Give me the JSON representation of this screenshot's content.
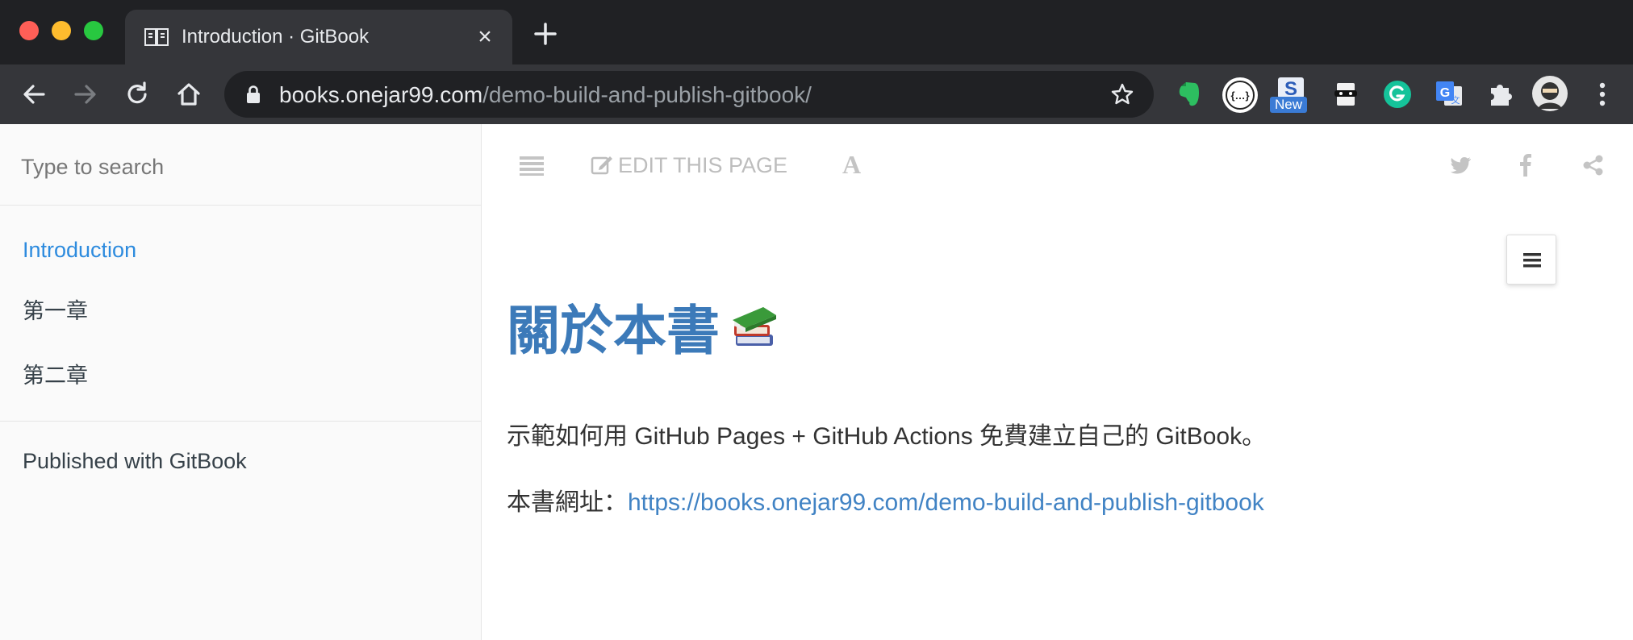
{
  "browser": {
    "tab_title": "Introduction · GitBook",
    "url_host": "books.onejar99.com",
    "url_path": "/demo-build-and-publish-gitbook/",
    "extensions": [
      "evernote-icon",
      "json-viewer-icon",
      "new-extension-icon",
      "spy-icon",
      "grammarly-icon",
      "google-translate-icon",
      "puzzle-icon",
      "profile-avatar"
    ],
    "new_badge": "New"
  },
  "sidebar": {
    "search_placeholder": "Type to search",
    "items": [
      {
        "label": "Introduction",
        "active": true
      },
      {
        "label": "第一章",
        "active": false
      },
      {
        "label": "第二章",
        "active": false
      }
    ],
    "footer": "Published with GitBook"
  },
  "header": {
    "edit_label": "EDIT THIS PAGE",
    "font_label": "A"
  },
  "content": {
    "title": "關於本書",
    "title_emoji": "books-icon",
    "description": "示範如何用 GitHub Pages + GitHub Actions 免費建立自己的 GitBook。",
    "url_label": "本書網址：",
    "url_link": "https://books.onejar99.com/demo-build-and-publish-gitbook"
  },
  "colors": {
    "active_link": "#2d8bde",
    "title": "#3c7ab9",
    "link": "#4183c4",
    "chrome_dark": "#202124",
    "chrome_toolbar": "#35363a"
  }
}
